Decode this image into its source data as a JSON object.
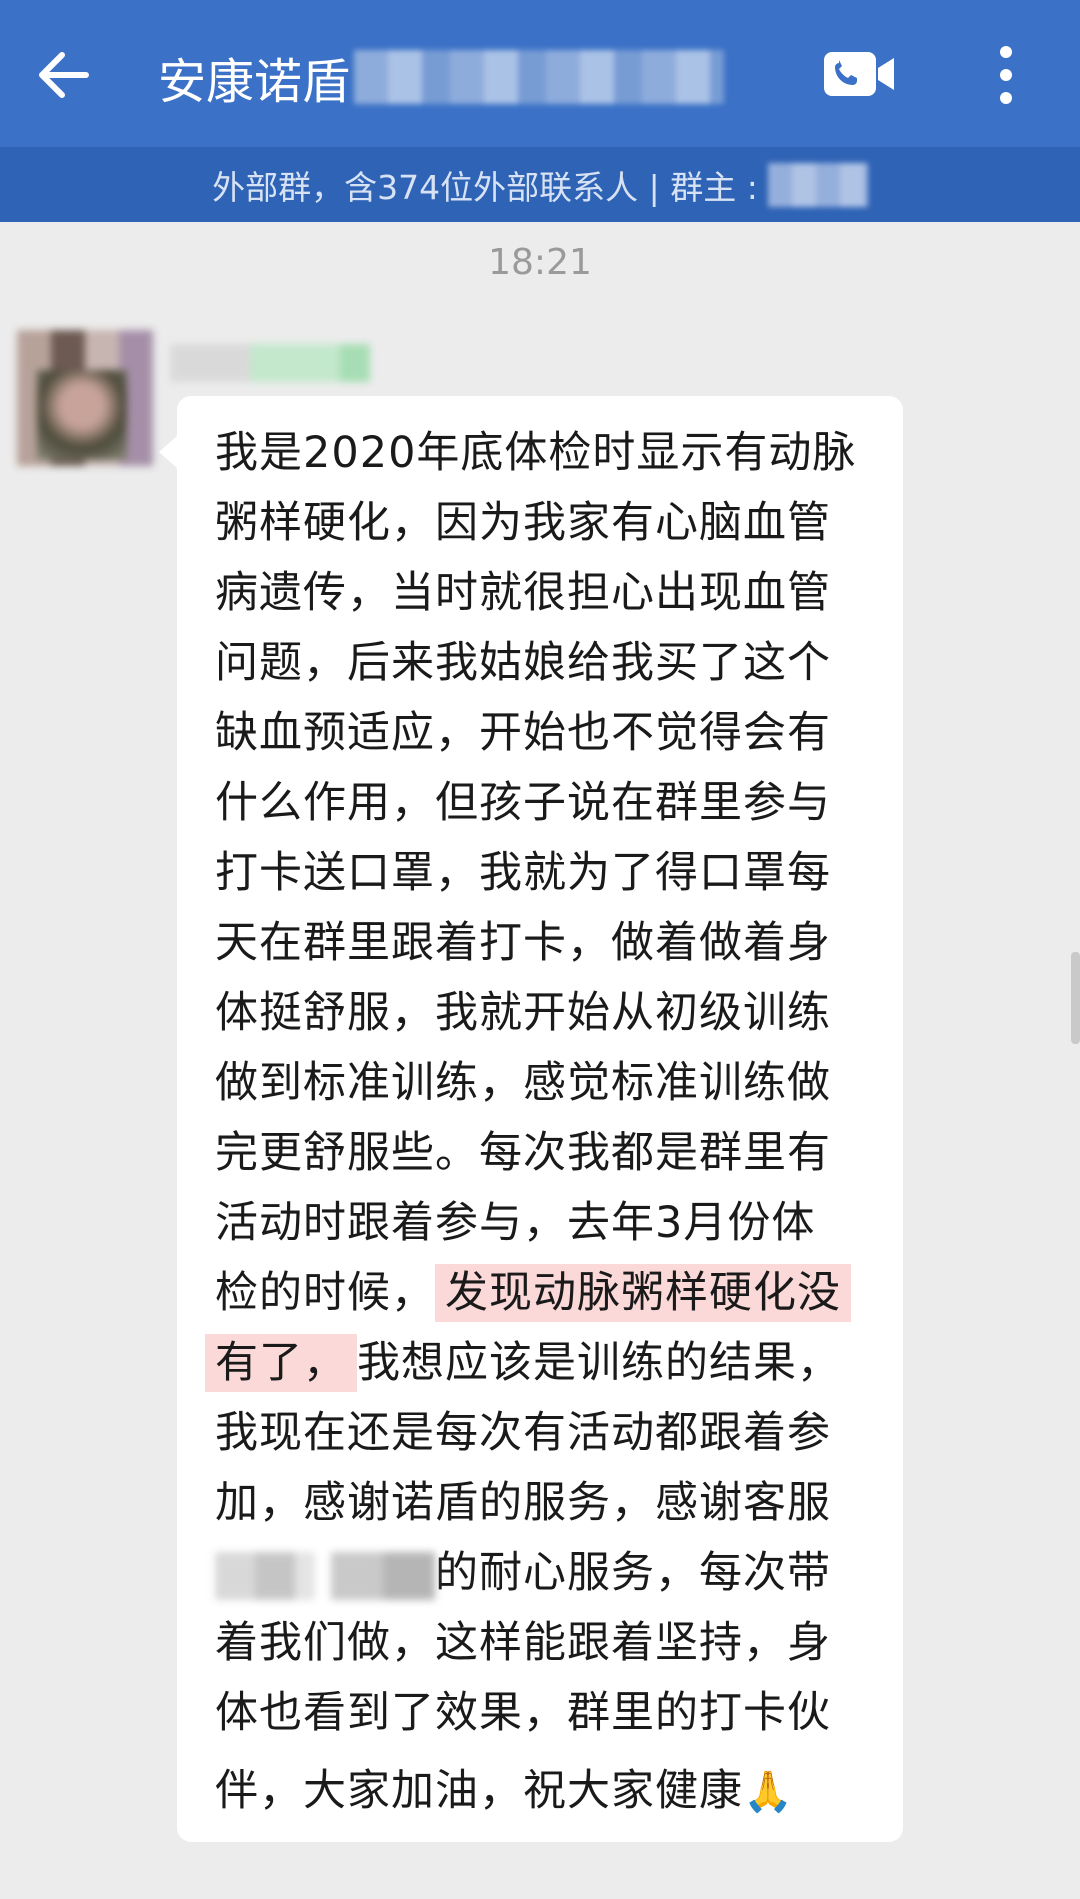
{
  "header": {
    "title": "安康诺盾",
    "icons": {
      "back": "arrow-left-icon",
      "video": "video-call-icon",
      "more": "more-vertical-icon"
    }
  },
  "subheader": {
    "text": "外部群，含374位外部联系人 | 群主 :"
  },
  "chat": {
    "timestamp": "18:21",
    "message": {
      "lines": [
        "我是2020年底体检时显示有动脉",
        "粥样硬化，因为我家有心脑血管",
        "病遗传，当时就很担心出现血管",
        "问题，后来我姑娘给我买了这个",
        "缺血预适应，开始也不觉得会有",
        "什么作用，但孩子说在群里参与",
        "打卡送口罩，我就为了得口罩每",
        "天在群里跟着打卡，做着做着身",
        "体挺舒服，我就开始从初级训练",
        "做到标准训练，感觉标准训练做",
        "完更舒服些。每次我都是群里有",
        "活动时跟着参与，去年3月份体"
      ],
      "line13_prefix": "检的时候，",
      "highlight_part1": "发现动脉粥样硬化没",
      "highlight_part2": "有了，",
      "line14_suffix": "我想应该是训练的结果，",
      "line15": "我现在还是每次有活动都跟着参",
      "line16": "加，感谢诺盾的服务，感谢客服",
      "line17_suffix": "的耐心服务，每次带",
      "line18": "着我们做，这样能跟着坚持，身",
      "line19": "体也看到了效果，群里的打卡伙",
      "line20_text": "伴，大家加油，祝大家健康",
      "line20_emoji": "🙏"
    }
  },
  "colors": {
    "header_bg": "#3b71c6",
    "subheader_bg": "#2f63b5",
    "chat_bg": "#ececec",
    "highlight": "#fbd9d8"
  }
}
